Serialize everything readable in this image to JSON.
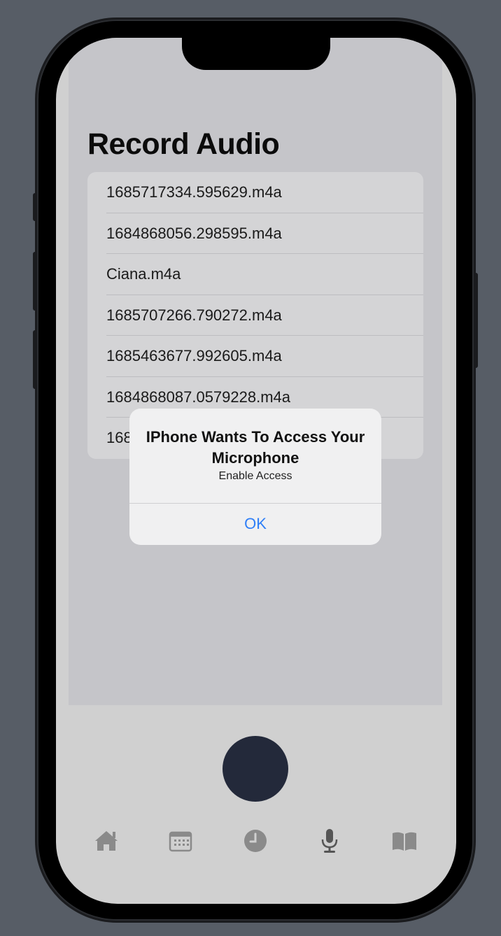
{
  "screen": {
    "title": "Record Audio",
    "recordings": [
      "1685717334.595629.m4a",
      "1684868056.298595.m4a",
      "Ciana.m4a",
      "1685707266.790272.m4a",
      "1685463677.992605.m4a",
      "1684868087.0579228.m4a",
      "168"
    ]
  },
  "alert": {
    "title": "IPhone Wants To Access Your Microphone",
    "message": "Enable Access",
    "ok_label": "OK"
  },
  "tabbar": {
    "items": [
      "home-icon",
      "calendar-icon",
      "clock-icon",
      "microphone-icon",
      "book-icon"
    ]
  },
  "colors": {
    "accent": "#2f7ff7",
    "record_button": "#23293a",
    "background": "#575d66"
  }
}
